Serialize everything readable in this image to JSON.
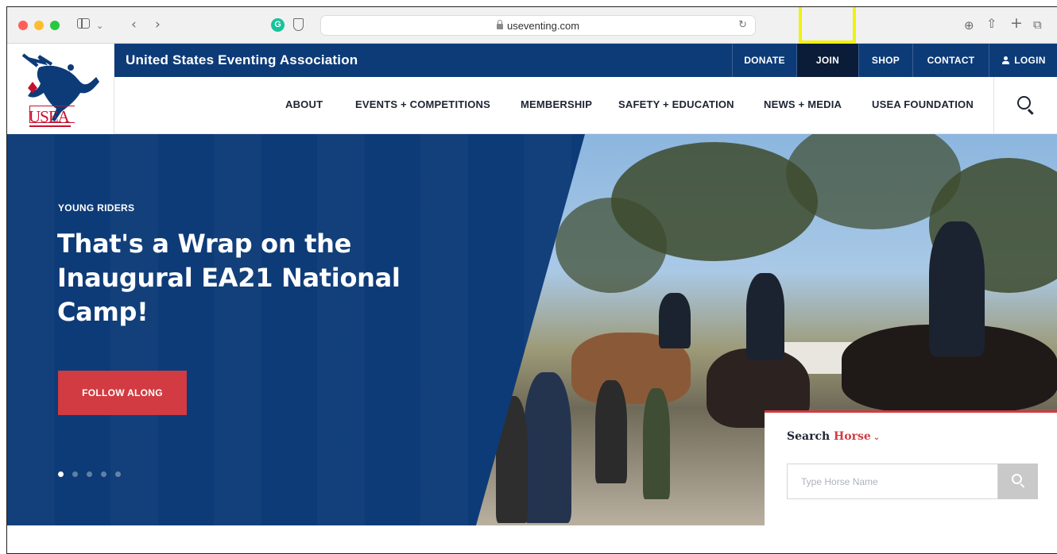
{
  "browser": {
    "url": "useventing.com"
  },
  "site": {
    "org_name": "United States Eventing Association",
    "logo_text": "USEA",
    "utility_nav": {
      "donate": "DONATE",
      "join": "JOIN",
      "shop": "SHOP",
      "contact": "CONTACT",
      "login": "LOGIN"
    },
    "main_nav": [
      {
        "label": "ABOUT"
      },
      {
        "label": "EVENTS + COMPETITIONS"
      },
      {
        "label": "MEMBERSHIP"
      },
      {
        "label": "SAFETY + EDUCATION"
      },
      {
        "label": "NEWS + MEDIA"
      },
      {
        "label": "USEA FOUNDATION"
      }
    ]
  },
  "hero": {
    "kicker": "YOUNG RIDERS",
    "headline": "That's a Wrap on the Inaugural EA21 National Camp!",
    "cta": "FOLLOW ALONG",
    "slides_total": 5,
    "slide_active": 1
  },
  "horse_search": {
    "title": "Search",
    "category": "Horse",
    "placeholder": "Type Horse Name"
  },
  "colors": {
    "brand_navy": "#0d3b78",
    "accent_red": "#d13b41",
    "join_highlight": "#f2f20a"
  }
}
